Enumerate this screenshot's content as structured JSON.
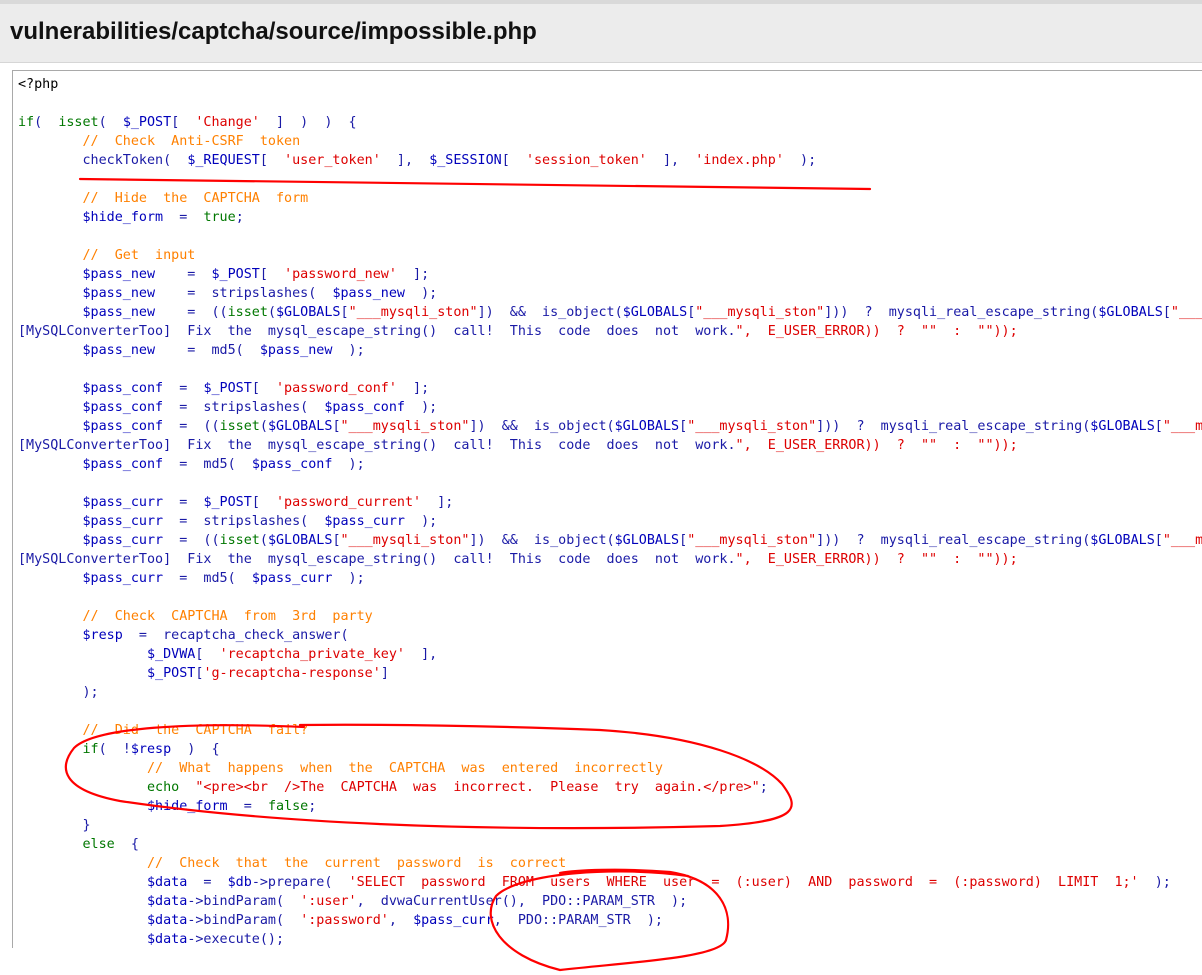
{
  "page": {
    "title": "vulnerabilities/captcha/source/impossible.php"
  },
  "code_lines": [
    "<?php",
    "",
    "if(  isset(  $_POST[  'Change'  ]  )  )  {",
    "        //  Check  Anti-CSRF  token",
    "        checkToken(  $_REQUEST[  'user_token'  ],  $_SESSION[  'session_token'  ],  'index.php'  );",
    "",
    "        //  Hide  the  CAPTCHA  form",
    "        $hide_form  =  true;",
    "",
    "        //  Get  input",
    "        $pass_new    =  $_POST[  'password_new'  ];",
    "        $pass_new    =  stripslashes(  $pass_new  );",
    "        $pass_new    =  ((isset($GLOBALS[\"___mysqli_ston\"])  &&  is_object($GLOBALS[\"___mysqli_ston\"]))  ?  mysqli_real_escape_string($GLOBALS[\"___mysqli_ston\"],  $pass_new  )  :  ((trigger_error(\"[MySQLConverterToo]  Fix  the  mysql_escape_string()  call!  This  code  does  not  work.\",  E_USER_ERROR))  ?  \"\"  :  \"\"));",
    "[MySQLConverterToo]  Fix  the  mysql_escape_string()  call!  This  code  does  not  work.\",  E_USER_ERROR))  ?  \"\"  :  \"\"));",
    "        $pass_new    =  md5(  $pass_new  );",
    "",
    "        $pass_conf  =  $_POST[  'password_conf'  ];",
    "        $pass_conf  =  stripslashes(  $pass_conf  );",
    "        $pass_conf  =  ((isset($GLOBALS[\"___mysqli_ston\"])  &&  is_object($GLOBALS[\"___mysqli_ston\"]))  ?  mysqli_real_escape_string($GLOBALS[\"___mysqli_ston\"],  $pass_conf  )  :  ((trigger_error(\"",
    "[MySQLConverterToo]  Fix  the  mysql_escape_string()  call!  This  code  does  not  work.\",  E_USER_ERROR))  ?  \"\"  :  \"\"));",
    "        $pass_conf  =  md5(  $pass_conf  );",
    "",
    "        $pass_curr  =  $_POST[  'password_current'  ];",
    "        $pass_curr  =  stripslashes(  $pass_curr  );",
    "        $pass_curr  =  ((isset($GLOBALS[\"___mysqli_ston\"])  &&  is_object($GLOBALS[\"___mysqli_ston\"]))  ?  mysqli_real_escape_string($GLOBALS[\"___mysqli_ston\"],  $pass_curr  )  :  ((trigger_error(\"",
    "[MySQLConverterToo]  Fix  the  mysql_escape_string()  call!  This  code  does  not  work.\",  E_USER_ERROR))  ?  \"\"  :  \"\"));",
    "        $pass_curr  =  md5(  $pass_curr  );",
    "",
    "        //  Check  CAPTCHA  from  3rd  party",
    "        $resp  =  recaptcha_check_answer(",
    "                $_DVWA[  'recaptcha_private_key'  ],",
    "                $_POST['g-recaptcha-response']",
    "        );",
    "",
    "        //  Did  the  CAPTCHA  fail?",
    "        if(  !$resp  )  {",
    "                //  What  happens  when  the  CAPTCHA  was  entered  incorrectly",
    "                echo  \"<pre><br  />The  CAPTCHA  was  incorrect.  Please  try  again.</pre>\";",
    "                $hide_form  =  false;",
    "        }",
    "        else  {",
    "                //  Check  that  the  current  password  is  correct",
    "                $data  =  $db->prepare(  'SELECT  password  FROM  users  WHERE  user  =  (:user)  AND  password  =  (:password)  LIMIT  1;'  );",
    "                $data->bindParam(  ':user',  dvwaCurrentUser(),  PDO::PARAM_STR  );",
    "                $data->bindParam(  ':password',  $pass_curr,  PDO::PARAM_STR  );",
    "                $data->execute();"
  ],
  "colors": {
    "header_bg": "#ececec",
    "annotation_stroke": "#ff0000",
    "comment": "#ff8000",
    "string": "#dd0000",
    "variable": "#0000bb"
  }
}
